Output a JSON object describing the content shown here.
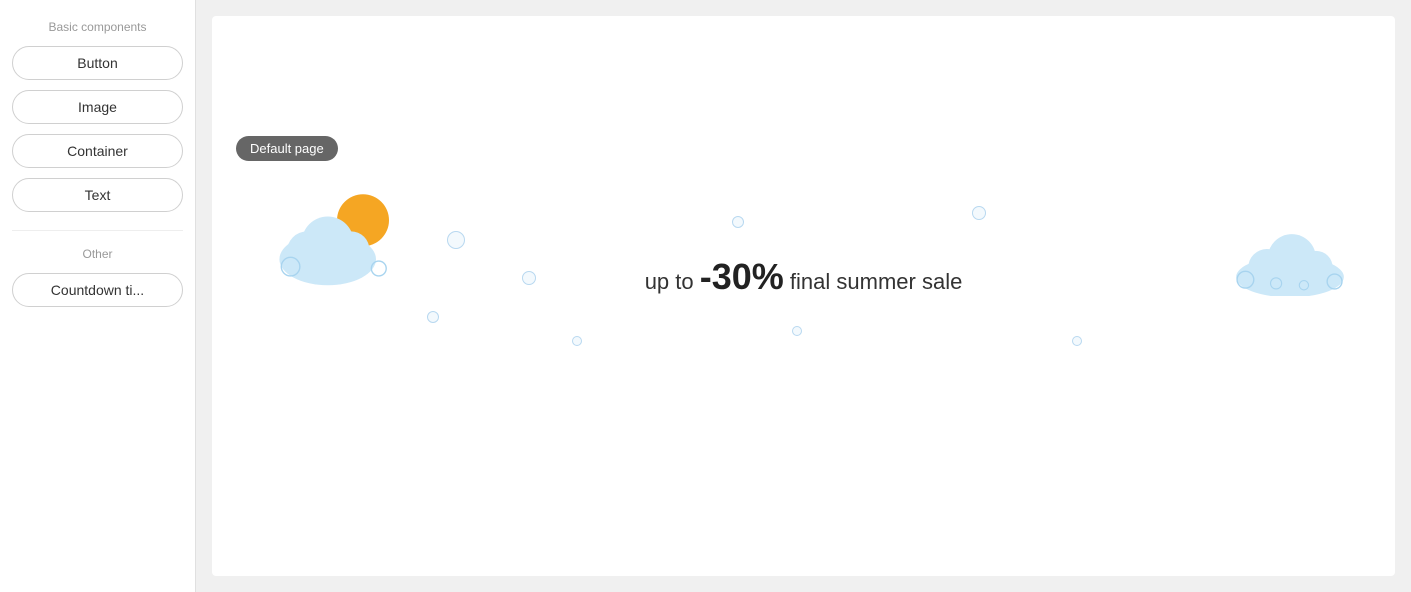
{
  "sidebar": {
    "basic_label": "Basic components",
    "other_label": "Other",
    "basic_items": [
      {
        "id": "button",
        "label": "Button"
      },
      {
        "id": "image",
        "label": "Image"
      },
      {
        "id": "container",
        "label": "Container"
      },
      {
        "id": "text",
        "label": "Text"
      }
    ],
    "other_items": [
      {
        "id": "countdown",
        "label": "Countdown ti..."
      }
    ]
  },
  "canvas": {
    "page_badge": "Default page",
    "sale_text_prefix": "up to",
    "sale_highlight": "-30%",
    "sale_text_suffix": "final summer sale"
  },
  "colors": {
    "badge_bg": "#666666",
    "cloud_blue": "#c5e3f7",
    "sun_orange": "#F5A623",
    "bubble_stroke": "#b8d4ec"
  }
}
